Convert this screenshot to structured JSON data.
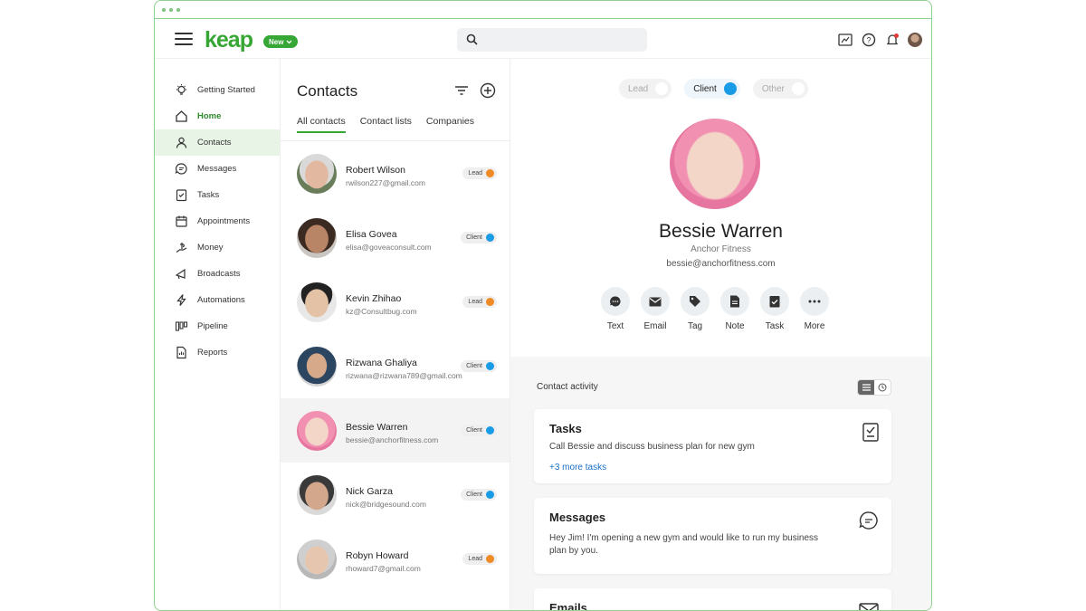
{
  "header": {
    "logo": "keap",
    "new_badge": "New",
    "search_placeholder": ""
  },
  "sidebar": {
    "items": [
      {
        "label": "Getting Started",
        "icon": "lightbulb-icon"
      },
      {
        "label": "Home",
        "icon": "home-icon"
      },
      {
        "label": "Contacts",
        "icon": "person-icon"
      },
      {
        "label": "Messages",
        "icon": "chat-icon"
      },
      {
        "label": "Tasks",
        "icon": "checklist-icon"
      },
      {
        "label": "Appointments",
        "icon": "calendar-icon"
      },
      {
        "label": "Money",
        "icon": "money-icon"
      },
      {
        "label": "Broadcasts",
        "icon": "megaphone-icon"
      },
      {
        "label": "Automations",
        "icon": "lightning-icon"
      },
      {
        "label": "Pipeline",
        "icon": "pipeline-icon"
      },
      {
        "label": "Reports",
        "icon": "report-icon"
      }
    ]
  },
  "contacts": {
    "title": "Contacts",
    "tabs": [
      "All contacts",
      "Contact lists",
      "Companies"
    ],
    "list": [
      {
        "name": "Robert Wilson",
        "email": "rwilson227@gmail.com",
        "status": "Lead"
      },
      {
        "name": "Elisa Govea",
        "email": "elisa@goveaconsult.com",
        "status": "Client"
      },
      {
        "name": "Kevin Zhihao",
        "email": "kz@Consultbug.com",
        "status": "Lead"
      },
      {
        "name": "Rizwana Ghaliya",
        "email": "rizwana@rizwana789@gmail.com",
        "status": "Client"
      },
      {
        "name": "Bessie Warren",
        "email": "bessie@anchorfitness.com",
        "status": "Client"
      },
      {
        "name": "Nick Garza",
        "email": "nick@bridgesound.com",
        "status": "Client"
      },
      {
        "name": "Robyn Howard",
        "email": "rhoward7@gmail.com",
        "status": "Lead"
      }
    ],
    "status_colors": {
      "Lead": "#f08a24",
      "Client": "#1a9be6"
    }
  },
  "profile": {
    "toggles": [
      "Lead",
      "Client",
      "Other"
    ],
    "name": "Bessie Warren",
    "company": "Anchor Fitness",
    "email": "bessie@anchorfitness.com",
    "actions": [
      "Text",
      "Email",
      "Tag",
      "Note",
      "Task",
      "More"
    ]
  },
  "activity": {
    "title": "Contact activity",
    "tasks": {
      "title": "Tasks",
      "text": "Call Bessie and discuss business plan for new gym",
      "link": "+3 more tasks"
    },
    "messages": {
      "title": "Messages",
      "text": "Hey Jim! I'm opening a new gym and would like to run my business plan by you."
    },
    "emails": {
      "title": "Emails"
    }
  },
  "colors": {
    "brand": "#36a635",
    "accent": "#1a9be6"
  }
}
